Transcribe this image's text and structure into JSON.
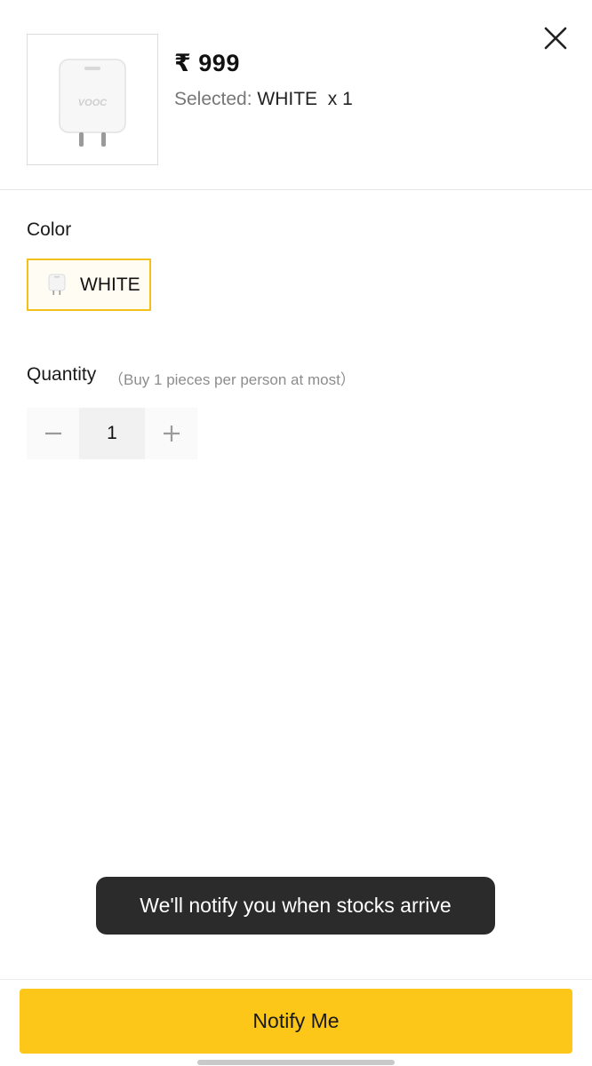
{
  "product": {
    "price": "₹ 999",
    "selected_prefix": "Selected: ",
    "selected_value": "WHITE  x 1",
    "image_icon": "charger-icon"
  },
  "header": {
    "close_icon": "close-icon"
  },
  "color_section": {
    "label": "Color",
    "options": [
      {
        "label": "WHITE",
        "icon": "charger-icon",
        "selected": true
      }
    ]
  },
  "quantity_section": {
    "label": "Quantity",
    "hint": "（Buy 1 pieces per person at most）",
    "value": "1",
    "decrement_icon": "minus-icon",
    "increment_icon": "plus-icon"
  },
  "toast": {
    "message": "We'll notify you when stocks arrive"
  },
  "footer": {
    "button_label": "Notify Me"
  },
  "colors": {
    "accent": "#fcc718",
    "chip_border": "#f2c21b",
    "toast_bg": "#2b2b2b"
  }
}
